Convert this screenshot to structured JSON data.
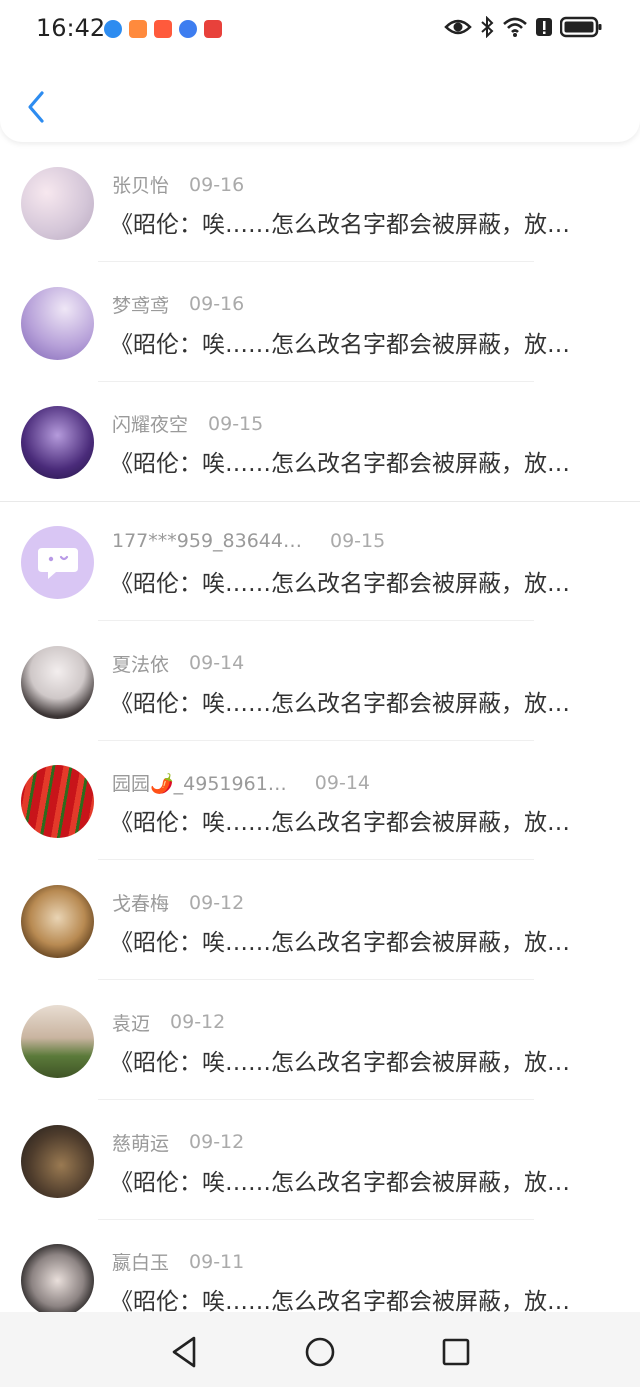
{
  "status_bar": {
    "time": "16:42"
  },
  "conversations": [
    {
      "name": "张贝怡",
      "date": "09-16",
      "message": "《昭伦：唉……怎么改名字都会被屏蔽，放…"
    },
    {
      "name": "梦鸢鸢",
      "date": "09-16",
      "message": "《昭伦：唉……怎么改名字都会被屏蔽，放…"
    },
    {
      "name": "闪耀夜空",
      "date": "09-15",
      "message": "《昭伦：唉……怎么改名字都会被屏蔽，放…"
    },
    {
      "name": "177***959_83644…",
      "date": "09-15",
      "message": "《昭伦：唉……怎么改名字都会被屏蔽，放…"
    },
    {
      "name": "夏法依",
      "date": "09-14",
      "message": "《昭伦：唉……怎么改名字都会被屏蔽，放…"
    },
    {
      "name": "园园🌶️_4951961…",
      "date": "09-14",
      "message": "《昭伦：唉……怎么改名字都会被屏蔽，放…"
    },
    {
      "name": "戈春梅",
      "date": "09-12",
      "message": "《昭伦：唉……怎么改名字都会被屏蔽，放…"
    },
    {
      "name": "袁迈",
      "date": "09-12",
      "message": "《昭伦：唉……怎么改名字都会被屏蔽，放…"
    },
    {
      "name": "慈萌运",
      "date": "09-12",
      "message": "《昭伦：唉……怎么改名字都会被屏蔽，放…"
    },
    {
      "name": "嬴白玉",
      "date": "09-11",
      "message": "《昭伦：唉……怎么改名字都会被屏蔽，放…"
    }
  ],
  "colors": {
    "accent": "#2d8cf0",
    "muted": "#9a9a9a"
  }
}
